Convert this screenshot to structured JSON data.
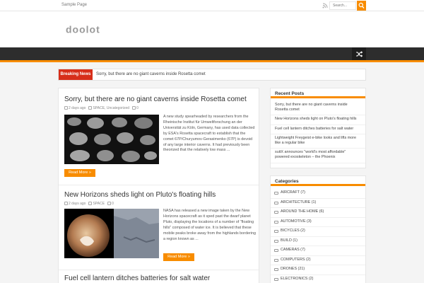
{
  "topbar": {
    "sample_page": "Sample Page",
    "search_placeholder": "Search..."
  },
  "logo": {
    "text": "doolot",
    "accent": "#f88c00"
  },
  "colors": {
    "accent": "#f88c00",
    "breaking": "#d72e1a",
    "nav": "#2d2d2d"
  },
  "breaking": {
    "label": "Breaking News",
    "headline": "Sorry, but there are no giant caverns inside Rosetta comet"
  },
  "posts": [
    {
      "title": "Sorry, but there are no giant caverns inside Rosetta comet",
      "date": "2 days ago",
      "categories": "SPACE, Uncategorized",
      "comments": "0",
      "excerpt": "A new study spearheaded by researchers from the Rheinische Institut für Umweltforschung an der Universität zu Köln, Germany, has used data collected by ESA's Rosetta spacecraft to establish that the comet 67P/Churyumov-Gerasimenko (67P) is devoid of any large interior caverns. It had previously been theorized that the relatively low mass ...",
      "read_more": "Read More »"
    },
    {
      "title": "New Horizons sheds light on Pluto's floating hills",
      "date": "2 days ago",
      "categories": "SPACE",
      "comments": "0",
      "excerpt": "NASA has released a new image taken by the New Horizons spacecraft as it sped past the dwarf planet Pluto, displaying the locations of a number of \"floating hills\" composed of water ice. It is believed that these mobile peaks broke away from the highlands bordering a region known as ...",
      "read_more": "Read More »"
    },
    {
      "title": "Fuel cell lantern ditches batteries for salt water"
    }
  ],
  "recent_posts": {
    "title": "Recent Posts",
    "items": [
      "Sorry, but there are no giant caverns inside Rosetta comet",
      "New Horizons sheds light on Pluto's floating hills",
      "Fuel cell lantern ditches batteries for salt water",
      "Lightweight Freygeist e-bike looks and lifts more like a regular bike",
      "suitX announces \"world's most affordable\" powered exoskeleton – the Phoenix"
    ]
  },
  "categories": {
    "title": "Categories",
    "items": [
      "AIRCRAFT (7)",
      "ARCHITECTURE (1)",
      "AROUND THE HOME (6)",
      "AUTOMOTIVE (3)",
      "BICYCLES (2)",
      "BUILD (1)",
      "CAMERAS (7)",
      "COMPUTERS (2)",
      "DRONES (21)",
      "ELECTRONICS (2)"
    ]
  }
}
